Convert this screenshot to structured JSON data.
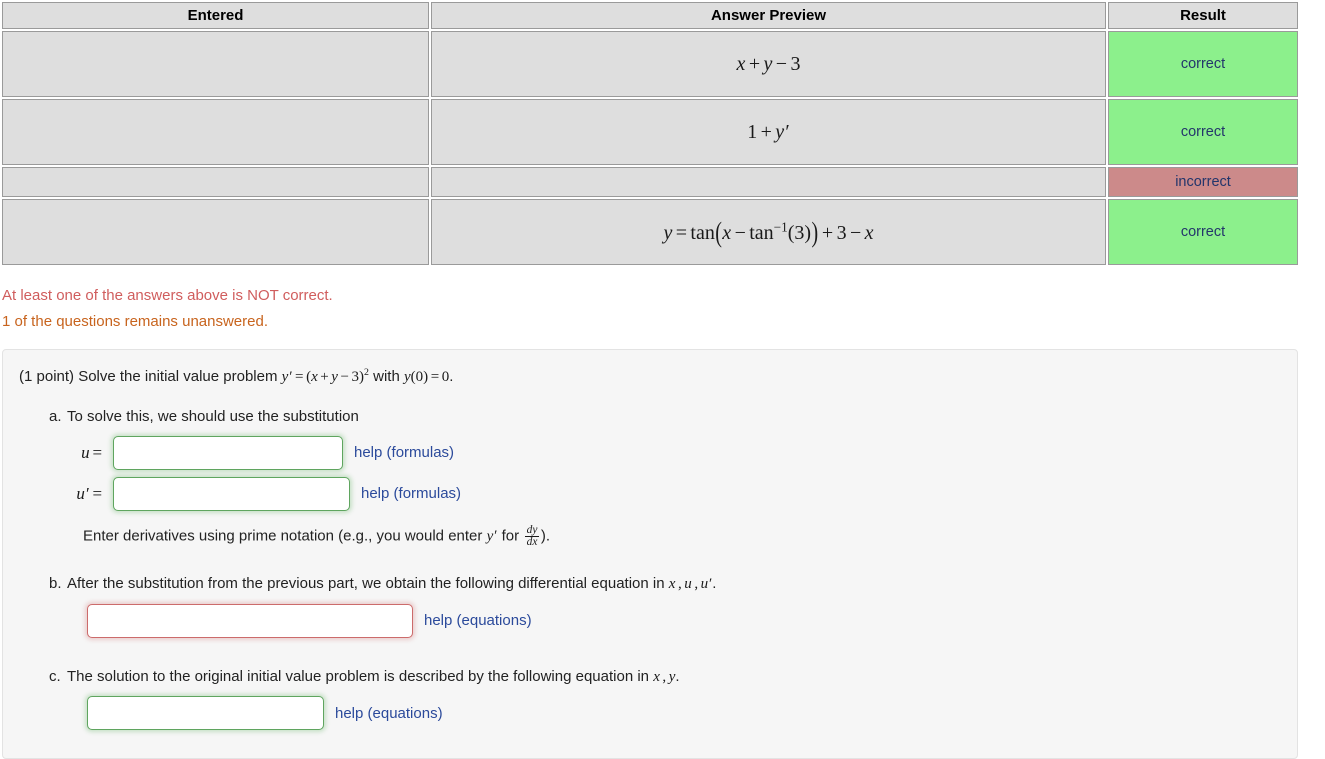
{
  "results_table": {
    "headers": [
      "Entered",
      "Answer Preview",
      "Result"
    ],
    "rows": [
      {
        "entered": "",
        "preview": "x + y - 3",
        "result": "correct",
        "status": "correct"
      },
      {
        "entered": "",
        "preview": "1 + y'",
        "result": "correct",
        "status": "correct"
      },
      {
        "entered": "",
        "preview": "",
        "result": "incorrect",
        "status": "incorrect"
      },
      {
        "entered": "",
        "preview": "y = tan(x - tan^-1(3)) + 3 - x",
        "result": "correct",
        "status": "correct"
      }
    ]
  },
  "messages": {
    "not_correct": "At least one of the answers above is NOT correct.",
    "unanswered": "1 of the questions remains unanswered."
  },
  "problem": {
    "points_label": "(1 point)",
    "prompt_text": "Solve the initial value problem",
    "prompt_equation": "y' = (x + y - 3)^2",
    "prompt_with": "with",
    "prompt_condition": "y(0) = 0",
    "prompt_period": ".",
    "parts": [
      {
        "letter": "a.",
        "text": "To solve this, we should use the substitution",
        "fields": [
          {
            "label": "u =",
            "value": "",
            "placeholder": "",
            "state": "ok",
            "help": "help (formulas)"
          },
          {
            "label": "u' =",
            "value": "",
            "placeholder": "",
            "state": "ok",
            "help": "help (formulas)"
          }
        ],
        "note_prefix": "Enter derivatives using prime notation (e.g., you would enter",
        "note_math": "y'",
        "note_mid": "for",
        "note_frac_num": "dy",
        "note_frac_den": "dx",
        "note_suffix": ")."
      },
      {
        "letter": "b.",
        "text": "After the substitution from the previous part, we obtain the following differential equation in",
        "vars": "x, u, u'",
        "text_end": ".",
        "fields": [
          {
            "label": "",
            "value": "",
            "placeholder": "",
            "state": "bad",
            "help": "help (equations)"
          }
        ]
      },
      {
        "letter": "c.",
        "text": "The solution to the original initial value problem is described by the following equation in",
        "vars": "x, y",
        "text_end": ".",
        "fields": [
          {
            "label": "",
            "value": "",
            "placeholder": "",
            "state": "ok",
            "help": "help (equations)"
          }
        ]
      }
    ]
  },
  "colors": {
    "correct_bg": "#8cf08c",
    "incorrect_bg": "#cc8a8a",
    "result_text": "#23356b",
    "msg_not_correct": "#d05d5d",
    "msg_unanswered": "#c8641e",
    "help_link": "#2b4a9b",
    "cell_bg": "#dedede",
    "panel_bg": "#f6f6f6"
  }
}
